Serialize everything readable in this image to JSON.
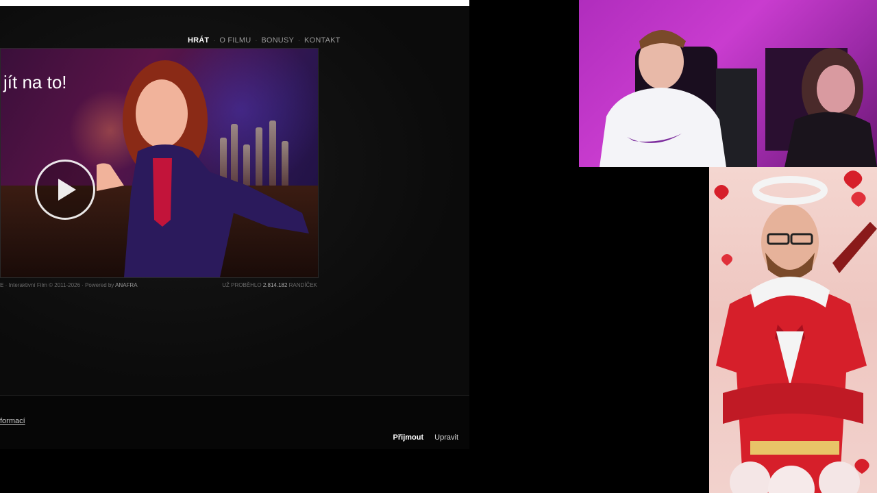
{
  "nav": {
    "items": [
      {
        "label": "HRÁT",
        "active": true
      },
      {
        "label": "O FILMU",
        "active": false
      },
      {
        "label": "BONUSY",
        "active": false
      },
      {
        "label": "KONTAKT",
        "active": false
      }
    ]
  },
  "hero": {
    "title": "jít na to!"
  },
  "footer": {
    "left_prefix": "E",
    "copyright": "Interaktivní Film © 2011-2026",
    "powered_by": "Powered by",
    "powered_by_brand": "ANAFRA",
    "dates_prefix": "UŽ PROBĚHLO",
    "dates_count": "2.814.182",
    "dates_suffix": "RANDÍČEK"
  },
  "cookie": {
    "info_link": "formací",
    "accept_label": "Přijmout",
    "edit_label": "Upravit"
  },
  "colors": {
    "accent_purple": "#c93ccf",
    "valentine_red": "#d61f2a"
  }
}
